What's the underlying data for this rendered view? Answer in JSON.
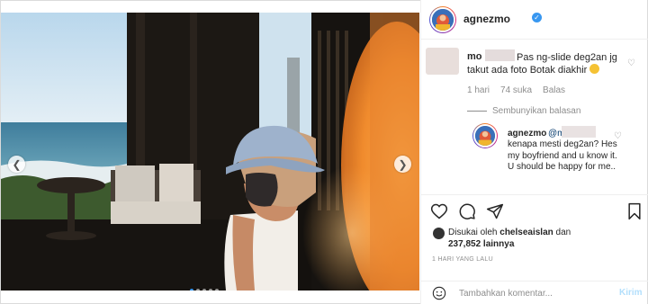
{
  "post": {
    "author": "agnezmo",
    "verified": true,
    "carousel": {
      "slides": 5,
      "active_index": 0
    }
  },
  "comment": {
    "user": "mo",
    "text": "Pas ng-slide deg2an jg takut ada foto Botak diakhir",
    "time": "1 hari",
    "likes": "74 suka",
    "reply_label": "Balas"
  },
  "hide_replies": "Sembunyikan balasan",
  "reply": {
    "user": "agnezmo",
    "mention": "@mo",
    "text": "kenapa mesti deg2an? Hes my boyfriend and u know it. U should be happy for me.."
  },
  "likes": {
    "prefix": "Disukai oleh",
    "user": "chelseaislan",
    "joiner": "dan",
    "count": "237,852 lainnya"
  },
  "timestamp": "1 HARI YANG LALU",
  "add_comment": {
    "placeholder": "Tambahkan komentar...",
    "post_label": "Kirim"
  },
  "icons": {
    "prev": "chevron-left-icon",
    "next": "chevron-right-icon",
    "like": "heart-icon",
    "comment": "comment-icon",
    "share": "paper-plane-icon",
    "save": "bookmark-icon",
    "emoji": "smile-icon"
  },
  "colors": {
    "accent": "#3897f0",
    "muted": "#8e8e8e",
    "post_disabled": "#b2dffc"
  }
}
